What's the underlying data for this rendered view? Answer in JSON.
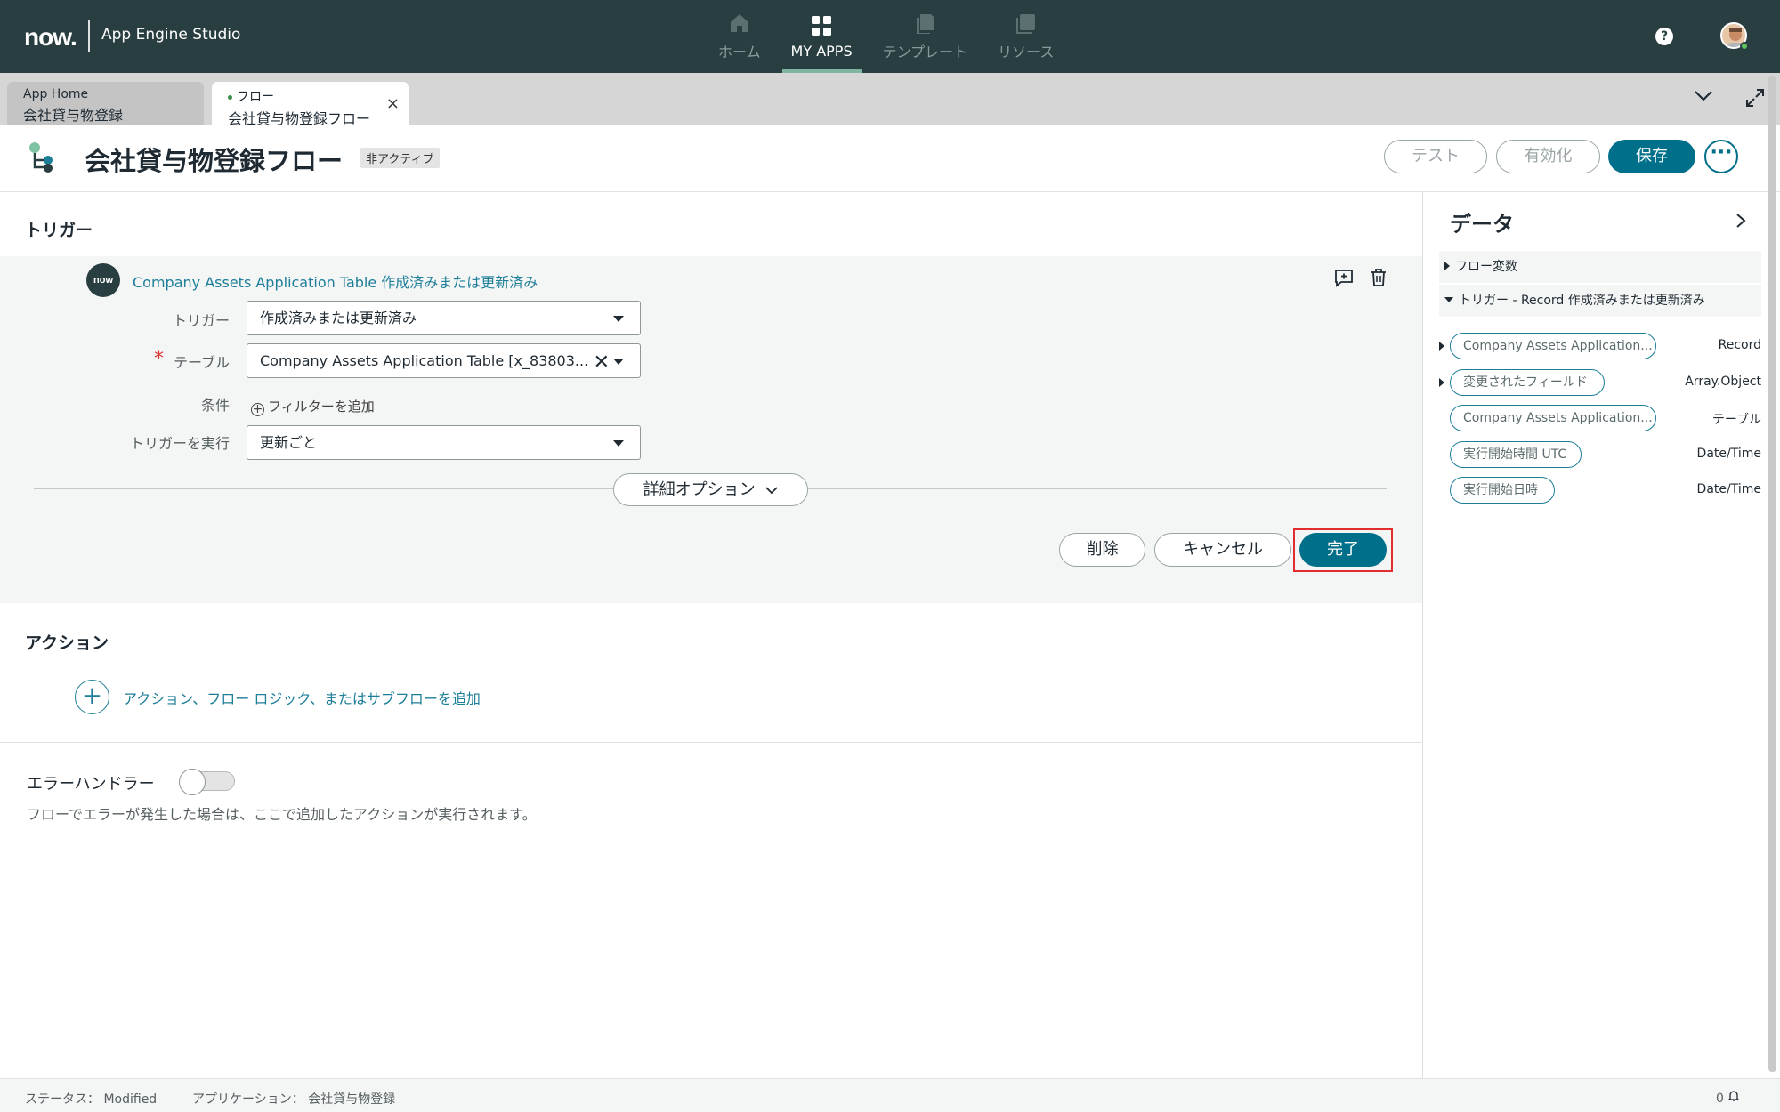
{
  "header": {
    "logo_text": "now.",
    "app_name": "App Engine Studio",
    "nav": [
      {
        "label": "ホーム",
        "icon": "home-icon",
        "active": false
      },
      {
        "label": "MY APPS",
        "icon": "apps-grid-icon",
        "active": true
      },
      {
        "label": "テンプレート",
        "icon": "template-icon",
        "active": false
      },
      {
        "label": "リソース",
        "icon": "resources-icon",
        "active": false
      }
    ],
    "help_label": "?"
  },
  "tabs": [
    {
      "small": "App Home",
      "big": "会社貸与物登録"
    },
    {
      "small": "フロー",
      "big": "会社貸与物登録フロー",
      "close": "×"
    }
  ],
  "flow": {
    "title": "会社貸与物登録フロー",
    "status": "非アクティブ",
    "test_label": "テスト",
    "activate_label": "有効化",
    "save_label": "保存",
    "more_label": "···"
  },
  "trigger": {
    "section_title": "トリガー",
    "logo_text": "now",
    "link_text": "Company Assets Application Table 作成済みまたは更新済み",
    "trigger_label": "トリガー",
    "trigger_value": "作成済みまたは更新済み",
    "required_mark": "*",
    "table_label": "テーブル",
    "table_value": "Company Assets Application Table [x_83803...",
    "condition_label": "条件",
    "add_filter_label": "フィルターを追加",
    "run_label": "トリガーを実行",
    "run_value": "更新ごと",
    "advanced_label": "詳細オプション",
    "delete_label": "削除",
    "cancel_label": "キャンセル",
    "done_label": "完了"
  },
  "actions": {
    "section_title": "アクション",
    "add_label": "アクション、フロー ロジック、またはサブフローを追加"
  },
  "error_handler": {
    "label": "エラーハンドラー",
    "enabled": false,
    "description": "フローでエラーが発生した場合は、ここで追加したアクションが実行されます。"
  },
  "data_panel": {
    "title": "データ",
    "groups": [
      {
        "label": "フロー変数",
        "expanded": false
      },
      {
        "label": "トリガー - Record 作成済みまたは更新済み",
        "expanded": true
      }
    ],
    "pills": [
      {
        "label": "Company Assets Application...",
        "type": "Record",
        "expandable": true
      },
      {
        "label": "変更されたフィールド",
        "type": "Array.Object",
        "expandable": true
      },
      {
        "label": "Company Assets Application...",
        "type": "テーブル",
        "expandable": false
      },
      {
        "label": "実行開始時間 UTC",
        "type": "Date/Time",
        "expandable": false
      },
      {
        "label": "実行開始日時",
        "type": "Date/Time",
        "expandable": false
      }
    ]
  },
  "footer": {
    "status": "ステータス： Modified",
    "application": "アプリケーション： 会社貸与物登録",
    "notifications": "0"
  },
  "colors": {
    "header_bg": "#293e40",
    "accent": "#006f8a",
    "link": "#1c7e99",
    "highlight_border": "#e12d2d"
  }
}
